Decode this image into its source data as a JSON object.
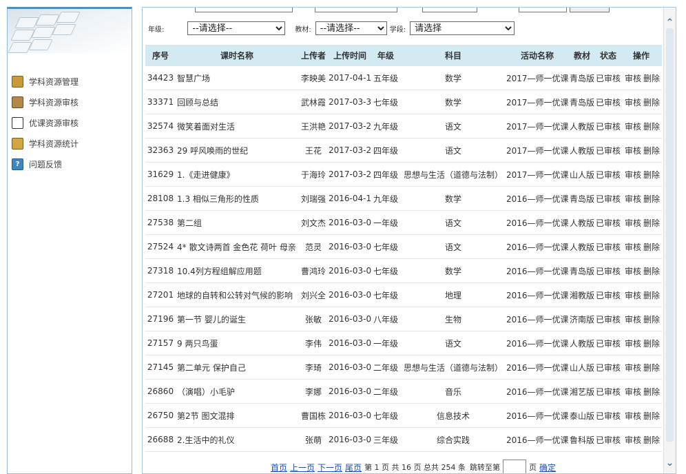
{
  "sidebar": {
    "items": [
      {
        "label": "学科资源管理",
        "icon": "folder-icon"
      },
      {
        "label": "学科资源审核",
        "icon": "audit-book-icon"
      },
      {
        "label": "优课资源审核",
        "icon": "document-icon"
      },
      {
        "label": "学科资源统计",
        "icon": "folder-stats-icon"
      },
      {
        "label": "问题反馈",
        "icon": "help-icon"
      }
    ]
  },
  "filters": {
    "grade_label": "年级:",
    "grade_value": "--请选择--",
    "textbook_label": "教材:",
    "textbook_value": "--请选择--",
    "stage_label": "学段:",
    "stage_value": "请选择"
  },
  "table": {
    "headers": [
      "序号",
      "课时名称",
      "上传者",
      "上传时间",
      "年级",
      "科目",
      "活动名称",
      "教材",
      "状态",
      "操作"
    ],
    "action_audit": "审核",
    "action_delete": "删除",
    "rows": [
      {
        "id": "34423",
        "name": "智慧广场",
        "uploader": "李映美",
        "date": "2017-04-12",
        "grade": "五年级",
        "subject": "数学",
        "activity": "2017—师一优课",
        "textbook": "青岛版",
        "status": "已审核"
      },
      {
        "id": "33371",
        "name": "回顾与总结",
        "uploader": "武林霞",
        "date": "2017-03-30",
        "grade": "七年级",
        "subject": "数学",
        "activity": "2017—师一优课",
        "textbook": "青岛版",
        "status": "已审核"
      },
      {
        "id": "32574",
        "name": "微笑着面对生活",
        "uploader": "王洪艳",
        "date": "2017-03-23",
        "grade": "九年级",
        "subject": "语文",
        "activity": "2017—师一优课",
        "textbook": "人教版",
        "status": "已审核"
      },
      {
        "id": "32363",
        "name": "29 呼风唤雨的世纪",
        "uploader": "王花",
        "date": "2017-03-23",
        "grade": "四年级",
        "subject": "语文",
        "activity": "2017—师一优课",
        "textbook": "人教版",
        "status": "已审核"
      },
      {
        "id": "31629",
        "name": "1.《走进健康》",
        "uploader": "于海玲",
        "date": "2017-03-22",
        "grade": "四年级",
        "subject": "思想与生活（道德与法制）",
        "activity": "2017—师一优课",
        "textbook": "山人版",
        "status": "已审核"
      },
      {
        "id": "28108",
        "name": "1.3 相似三角形的性质",
        "uploader": "刘瑞强",
        "date": "2016-04-13",
        "grade": "九年级",
        "subject": "数学",
        "activity": "2016—师一优课",
        "textbook": "青岛版",
        "status": "已审核"
      },
      {
        "id": "27538",
        "name": "第二组",
        "uploader": "刘文杰",
        "date": "2016-03-04",
        "grade": "一年级",
        "subject": "语文",
        "activity": "2016—师一优课",
        "textbook": "人教版",
        "status": "已审核"
      },
      {
        "id": "27524",
        "name": "4* 散文诗两首 金色花 荷叶 母亲",
        "uploader": "范灵",
        "date": "2016-03-04",
        "grade": "七年级",
        "subject": "语文",
        "activity": "2016—师一优课",
        "textbook": "人教版",
        "status": "已审核"
      },
      {
        "id": "27318",
        "name": "10.4列方程组解应用题",
        "uploader": "曹鸿玲",
        "date": "2016-03-03",
        "grade": "七年级",
        "subject": "数学",
        "activity": "2016—师一优课",
        "textbook": "青岛版",
        "status": "已审核"
      },
      {
        "id": "27201",
        "name": "地球的自转和公转对气候的影响",
        "uploader": "刘兴全",
        "date": "2016-03-03",
        "grade": "七年级",
        "subject": "地理",
        "activity": "2016—师一优课",
        "textbook": "湘教版",
        "status": "已审核"
      },
      {
        "id": "27196",
        "name": "第一节 婴儿的诞生",
        "uploader": "张敏",
        "date": "2016-03-03",
        "grade": "八年级",
        "subject": "生物",
        "activity": "2016—师一优课",
        "textbook": "济南版",
        "status": "已审核"
      },
      {
        "id": "27157",
        "name": "9 两只鸟蛋",
        "uploader": "李伟",
        "date": "2016-03-02",
        "grade": "一年级",
        "subject": "语文",
        "activity": "2016—师一优课",
        "textbook": "人教版",
        "status": "已审核"
      },
      {
        "id": "27145",
        "name": "第二单元 保护自己",
        "uploader": "李琦",
        "date": "2016-03-02",
        "grade": "二年级",
        "subject": "思想与生活（道德与法制）",
        "activity": "2016—师一优课",
        "textbook": "山人版",
        "status": "已审核"
      },
      {
        "id": "26860",
        "name": "（演唱）小毛驴",
        "uploader": "李娜",
        "date": "2016-03-02",
        "grade": "二年级",
        "subject": "音乐",
        "activity": "2016—师一优课",
        "textbook": "湘艺版",
        "status": "已审核"
      },
      {
        "id": "26750",
        "name": "第2节 图文混排",
        "uploader": "曹国栋",
        "date": "2016-03-02",
        "grade": "七年级",
        "subject": "信息技术",
        "activity": "2016—师一优课",
        "textbook": "泰山版",
        "status": "已审核"
      },
      {
        "id": "26688",
        "name": "2.生活中的礼仪",
        "uploader": "张萌",
        "date": "2016-03-02",
        "grade": "三年级",
        "subject": "综合实践",
        "activity": "2016—师一优课",
        "textbook": "鲁科版",
        "status": "已审核"
      }
    ]
  },
  "pager": {
    "first": "首页",
    "prev": "上一页",
    "next": "下一页",
    "last": "尾页",
    "info": "第 1 页 共 16 页 总共 254 条",
    "jump_label": "跳转至第",
    "page_unit": "页",
    "confirm": "确定"
  },
  "colors": {
    "header_bg": "#d3eaf2",
    "status_ok": "#1a9b1a",
    "link": "#1d4fb5",
    "accent": "#4f8fc0"
  }
}
